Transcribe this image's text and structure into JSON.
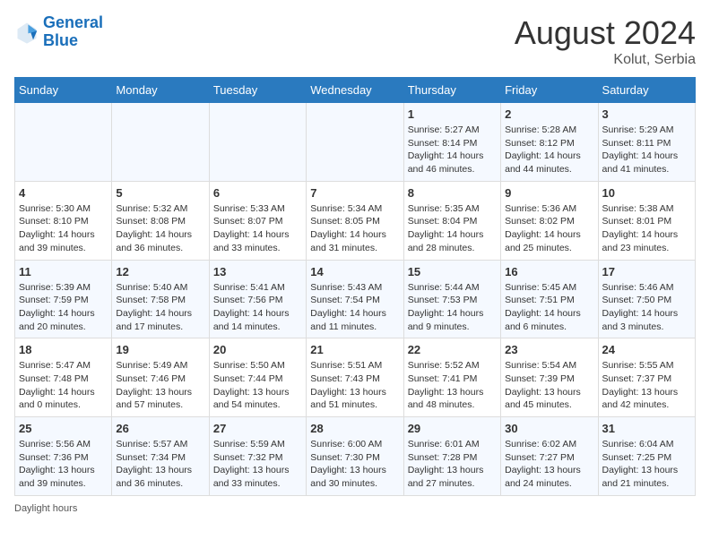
{
  "header": {
    "logo_text_general": "General",
    "logo_text_blue": "Blue",
    "month_year": "August 2024",
    "location": "Kolut, Serbia"
  },
  "days_of_week": [
    "Sunday",
    "Monday",
    "Tuesday",
    "Wednesday",
    "Thursday",
    "Friday",
    "Saturday"
  ],
  "weeks": [
    [
      {
        "day": "",
        "info": ""
      },
      {
        "day": "",
        "info": ""
      },
      {
        "day": "",
        "info": ""
      },
      {
        "day": "",
        "info": ""
      },
      {
        "day": "1",
        "info": "Sunrise: 5:27 AM\nSunset: 8:14 PM\nDaylight: 14 hours and 46 minutes."
      },
      {
        "day": "2",
        "info": "Sunrise: 5:28 AM\nSunset: 8:12 PM\nDaylight: 14 hours and 44 minutes."
      },
      {
        "day": "3",
        "info": "Sunrise: 5:29 AM\nSunset: 8:11 PM\nDaylight: 14 hours and 41 minutes."
      }
    ],
    [
      {
        "day": "4",
        "info": "Sunrise: 5:30 AM\nSunset: 8:10 PM\nDaylight: 14 hours and 39 minutes."
      },
      {
        "day": "5",
        "info": "Sunrise: 5:32 AM\nSunset: 8:08 PM\nDaylight: 14 hours and 36 minutes."
      },
      {
        "day": "6",
        "info": "Sunrise: 5:33 AM\nSunset: 8:07 PM\nDaylight: 14 hours and 33 minutes."
      },
      {
        "day": "7",
        "info": "Sunrise: 5:34 AM\nSunset: 8:05 PM\nDaylight: 14 hours and 31 minutes."
      },
      {
        "day": "8",
        "info": "Sunrise: 5:35 AM\nSunset: 8:04 PM\nDaylight: 14 hours and 28 minutes."
      },
      {
        "day": "9",
        "info": "Sunrise: 5:36 AM\nSunset: 8:02 PM\nDaylight: 14 hours and 25 minutes."
      },
      {
        "day": "10",
        "info": "Sunrise: 5:38 AM\nSunset: 8:01 PM\nDaylight: 14 hours and 23 minutes."
      }
    ],
    [
      {
        "day": "11",
        "info": "Sunrise: 5:39 AM\nSunset: 7:59 PM\nDaylight: 14 hours and 20 minutes."
      },
      {
        "day": "12",
        "info": "Sunrise: 5:40 AM\nSunset: 7:58 PM\nDaylight: 14 hours and 17 minutes."
      },
      {
        "day": "13",
        "info": "Sunrise: 5:41 AM\nSunset: 7:56 PM\nDaylight: 14 hours and 14 minutes."
      },
      {
        "day": "14",
        "info": "Sunrise: 5:43 AM\nSunset: 7:54 PM\nDaylight: 14 hours and 11 minutes."
      },
      {
        "day": "15",
        "info": "Sunrise: 5:44 AM\nSunset: 7:53 PM\nDaylight: 14 hours and 9 minutes."
      },
      {
        "day": "16",
        "info": "Sunrise: 5:45 AM\nSunset: 7:51 PM\nDaylight: 14 hours and 6 minutes."
      },
      {
        "day": "17",
        "info": "Sunrise: 5:46 AM\nSunset: 7:50 PM\nDaylight: 14 hours and 3 minutes."
      }
    ],
    [
      {
        "day": "18",
        "info": "Sunrise: 5:47 AM\nSunset: 7:48 PM\nDaylight: 14 hours and 0 minutes."
      },
      {
        "day": "19",
        "info": "Sunrise: 5:49 AM\nSunset: 7:46 PM\nDaylight: 13 hours and 57 minutes."
      },
      {
        "day": "20",
        "info": "Sunrise: 5:50 AM\nSunset: 7:44 PM\nDaylight: 13 hours and 54 minutes."
      },
      {
        "day": "21",
        "info": "Sunrise: 5:51 AM\nSunset: 7:43 PM\nDaylight: 13 hours and 51 minutes."
      },
      {
        "day": "22",
        "info": "Sunrise: 5:52 AM\nSunset: 7:41 PM\nDaylight: 13 hours and 48 minutes."
      },
      {
        "day": "23",
        "info": "Sunrise: 5:54 AM\nSunset: 7:39 PM\nDaylight: 13 hours and 45 minutes."
      },
      {
        "day": "24",
        "info": "Sunrise: 5:55 AM\nSunset: 7:37 PM\nDaylight: 13 hours and 42 minutes."
      }
    ],
    [
      {
        "day": "25",
        "info": "Sunrise: 5:56 AM\nSunset: 7:36 PM\nDaylight: 13 hours and 39 minutes."
      },
      {
        "day": "26",
        "info": "Sunrise: 5:57 AM\nSunset: 7:34 PM\nDaylight: 13 hours and 36 minutes."
      },
      {
        "day": "27",
        "info": "Sunrise: 5:59 AM\nSunset: 7:32 PM\nDaylight: 13 hours and 33 minutes."
      },
      {
        "day": "28",
        "info": "Sunrise: 6:00 AM\nSunset: 7:30 PM\nDaylight: 13 hours and 30 minutes."
      },
      {
        "day": "29",
        "info": "Sunrise: 6:01 AM\nSunset: 7:28 PM\nDaylight: 13 hours and 27 minutes."
      },
      {
        "day": "30",
        "info": "Sunrise: 6:02 AM\nSunset: 7:27 PM\nDaylight: 13 hours and 24 minutes."
      },
      {
        "day": "31",
        "info": "Sunrise: 6:04 AM\nSunset: 7:25 PM\nDaylight: 13 hours and 21 minutes."
      }
    ]
  ],
  "footer": {
    "daylight_hours": "Daylight hours"
  }
}
